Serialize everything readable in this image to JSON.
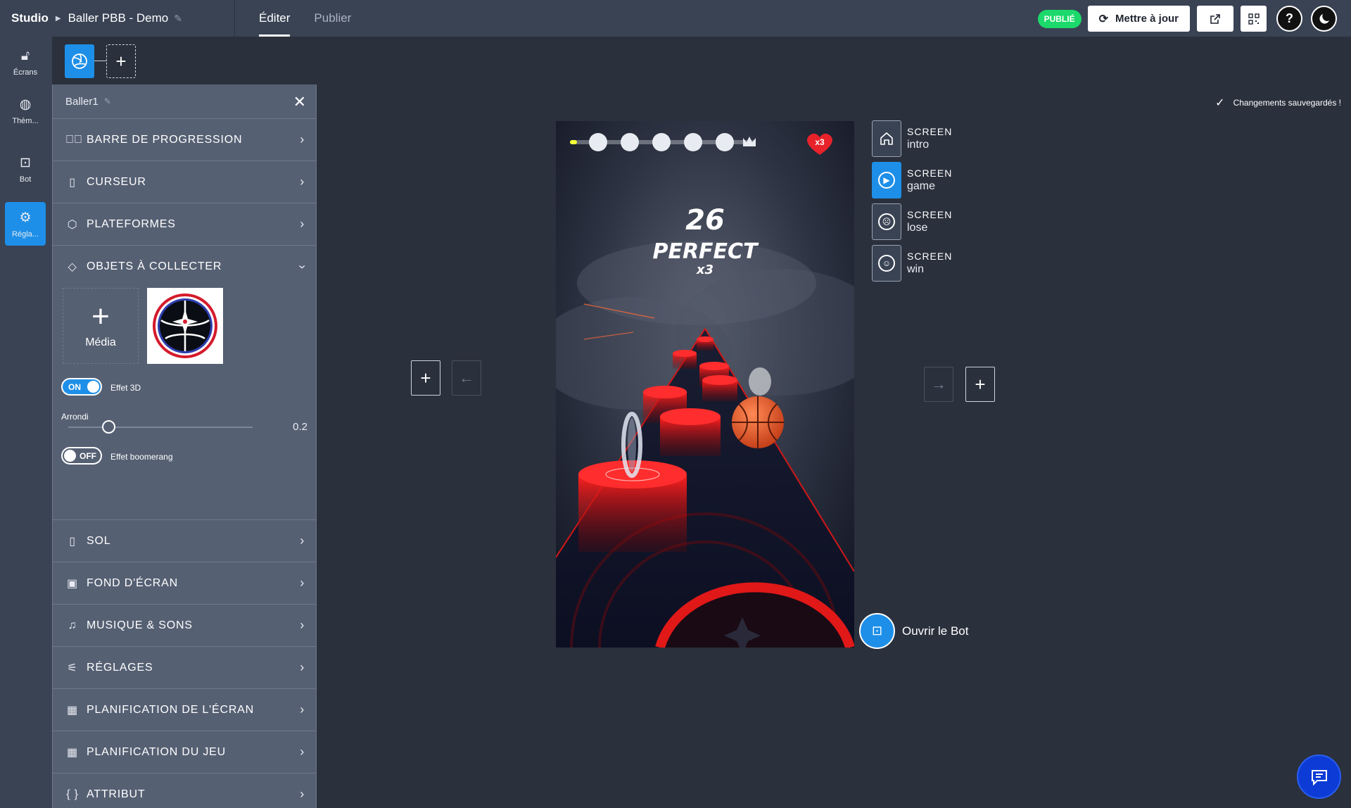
{
  "header": {
    "studio": "Studio",
    "project": "Baller PBB - Demo",
    "tabs": [
      "Éditer",
      "Publier"
    ],
    "badge": "PUBLIÉ",
    "update_label": "Mettre à jour"
  },
  "rail": {
    "items": [
      {
        "label": "Écrans",
        "icon": "lock-icon"
      },
      {
        "label": "Thèm...",
        "icon": "palette-icon"
      },
      {
        "label": "Bot",
        "icon": "robot-icon"
      },
      {
        "label": "Régla...",
        "icon": "gear-icon"
      }
    ]
  },
  "panel": {
    "title": "Baller1",
    "sections_top": [
      {
        "label": "BARRE DE PROGRESSION",
        "icon": "check-circle-icon"
      },
      {
        "label": "CURSEUR",
        "icon": "mouse-icon"
      },
      {
        "label": "PLATEFORMES",
        "icon": "cube-icon"
      },
      {
        "label": "OBJETS À COLLECTER",
        "icon": "diamond-icon"
      }
    ],
    "media_label": "Média",
    "effet3d": {
      "state": "ON",
      "label": "Effet 3D"
    },
    "arrondi": {
      "label": "Arrondi",
      "value": "0.2",
      "fraction": 0.2
    },
    "boomerang": {
      "state": "OFF",
      "label": "Effet boomerang"
    },
    "sections_bottom": [
      {
        "label": "SOL",
        "icon": "phone-icon"
      },
      {
        "label": "FOND D'ÉCRAN",
        "icon": "image-icon"
      },
      {
        "label": "MUSIQUE & SONS",
        "icon": "music-icon"
      },
      {
        "label": "RÉGLAGES",
        "icon": "sliders-icon"
      },
      {
        "label": "PLANIFICATION DE L'ÉCRAN",
        "icon": "calendar-icon"
      },
      {
        "label": "PLANIFICATION DU JEU",
        "icon": "calendar-icon"
      },
      {
        "label": "ATTRIBUT",
        "icon": "braces-icon"
      }
    ]
  },
  "canvas": {
    "saved_text": "Changements sauvegardés !",
    "game": {
      "score": "26",
      "combo_text": "PERFECT",
      "combo_mult": "x3",
      "lives": "x3"
    }
  },
  "screens": [
    {
      "kind": "SCREEN",
      "name": "intro",
      "icon": "home-icon"
    },
    {
      "kind": "SCREEN",
      "name": "game",
      "icon": "play-icon"
    },
    {
      "kind": "SCREEN",
      "name": "lose",
      "icon": "sad-face-icon"
    },
    {
      "kind": "SCREEN",
      "name": "win",
      "icon": "smile-face-icon"
    }
  ],
  "bot_open_label": "Ouvrir le Bot",
  "colors": {
    "accent": "#1e8fe8",
    "publish_badge": "#1bd96a",
    "track_red": "#e01818"
  }
}
